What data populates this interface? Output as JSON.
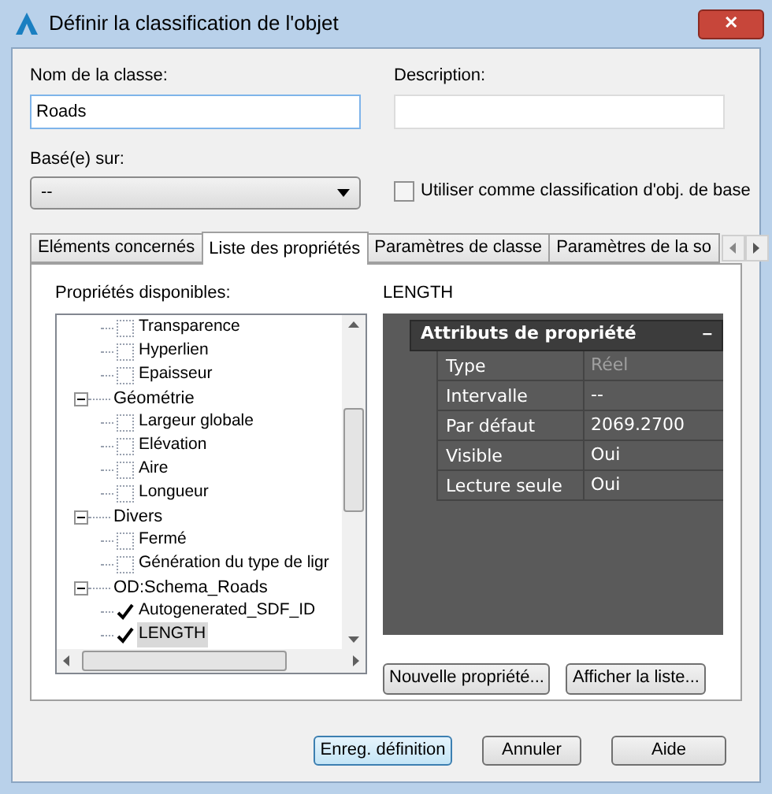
{
  "window": {
    "title": "Définir la classification de l'objet",
    "close": "✕"
  },
  "class_name": {
    "label": "Nom de la classe:",
    "value": "Roads"
  },
  "description": {
    "label": "Description:"
  },
  "based_on": {
    "label": "Basé(e) sur:",
    "value": "--"
  },
  "use_as_base": {
    "label": "Utiliser comme classification d'obj. de base",
    "checked": false
  },
  "tabs": [
    {
      "label": "Eléments concernés",
      "selected": false
    },
    {
      "label": "Liste des propriétés",
      "selected": true
    },
    {
      "label": "Paramètres de classe",
      "selected": false
    },
    {
      "label": "Paramètres de la so",
      "selected": false
    }
  ],
  "available": {
    "label": "Propriétés disponibles:",
    "tree": [
      {
        "children": [
          {
            "label": "Transparence",
            "checked": false,
            "selected": false
          },
          {
            "label": "Hyperlien",
            "checked": false,
            "selected": false
          },
          {
            "label": "Epaisseur",
            "checked": false,
            "selected": false
          }
        ]
      },
      {
        "label": "Géométrie",
        "expanded": true,
        "children": [
          {
            "label": "Largeur globale",
            "checked": false,
            "selected": false
          },
          {
            "label": "Elévation",
            "checked": false,
            "selected": false
          },
          {
            "label": "Aire",
            "checked": false,
            "selected": false
          },
          {
            "label": "Longueur",
            "checked": false,
            "selected": false
          }
        ]
      },
      {
        "label": "Divers",
        "expanded": true,
        "children": [
          {
            "label": "Fermé",
            "checked": false,
            "selected": false
          },
          {
            "label": "Génération du type de ligr",
            "checked": false,
            "selected": false
          }
        ]
      },
      {
        "label": "OD:Schema_Roads",
        "expanded": true,
        "children": [
          {
            "label": "Autogenerated_SDF_ID",
            "checked": true,
            "selected": false
          },
          {
            "label": "LENGTH",
            "checked": true,
            "selected": true
          }
        ]
      }
    ]
  },
  "property": {
    "name": "LENGTH",
    "section": {
      "title": "Attributs de propriété",
      "collapse": "–"
    },
    "rows": [
      {
        "name": "Type",
        "value": "Réel",
        "disabled": true
      },
      {
        "name": "Intervalle",
        "value": "--",
        "disabled": false
      },
      {
        "name": "Par défaut",
        "value": "2069.2700",
        "disabled": false
      },
      {
        "name": "Visible",
        "value": "Oui",
        "disabled": false
      },
      {
        "name": "Lecture seule",
        "value": "Oui",
        "disabled": false
      }
    ]
  },
  "panel_buttons": [
    "Nouvelle propriété...",
    "Afficher la liste..."
  ],
  "buttons": [
    {
      "label": "Enreg. définition",
      "default": true
    },
    {
      "label": "Annuler",
      "default": false
    },
    {
      "label": "Aide",
      "default": false
    }
  ]
}
